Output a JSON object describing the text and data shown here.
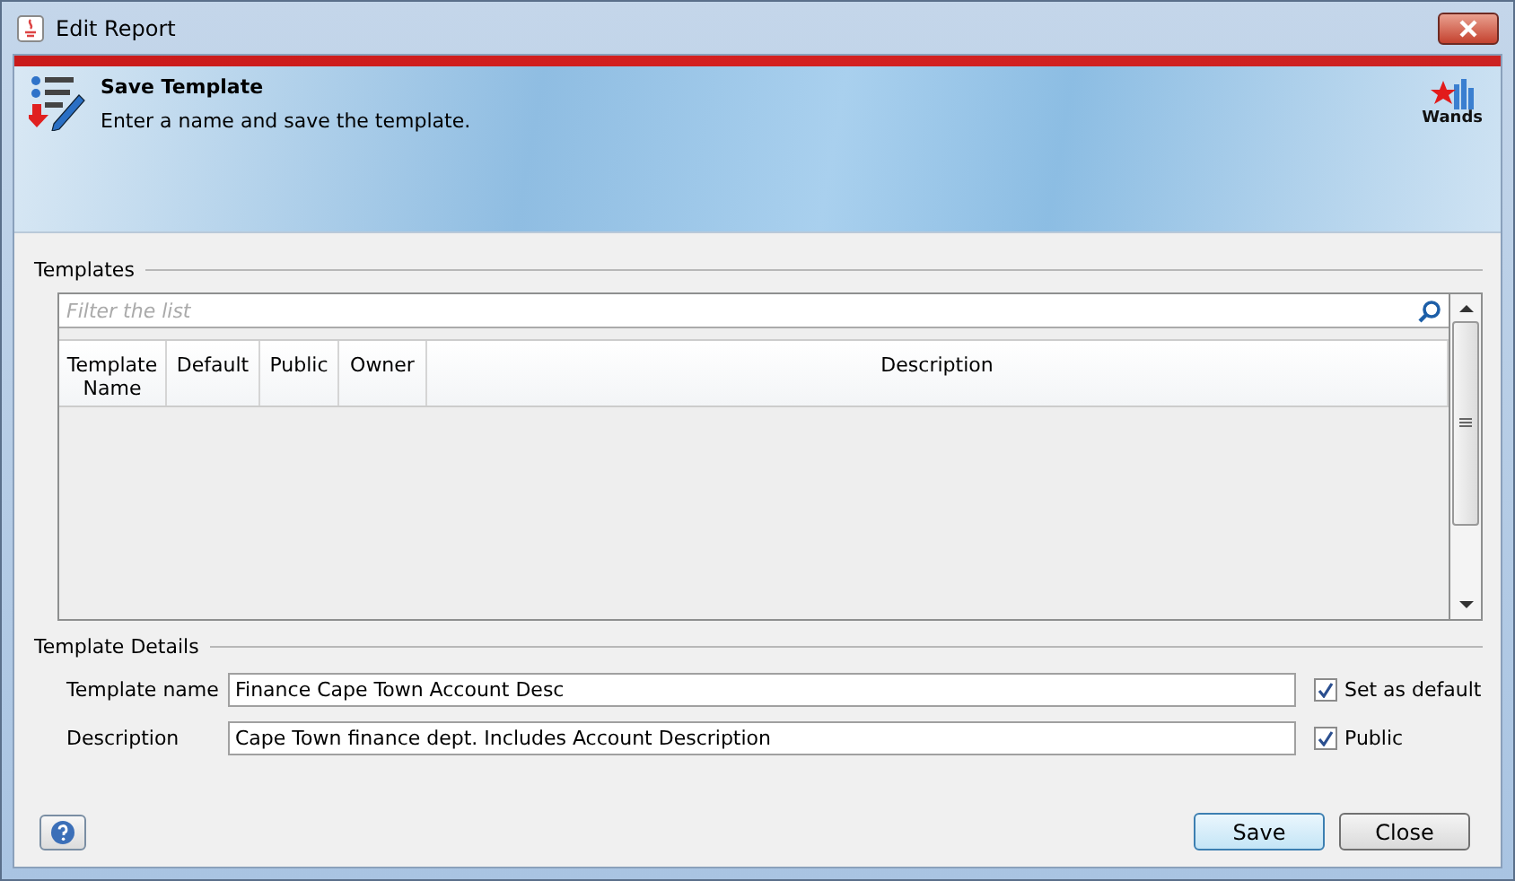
{
  "window": {
    "title": "Edit Report"
  },
  "header": {
    "title": "Save Template",
    "subtitle": "Enter a name and save the template.",
    "logo_text": "Wands"
  },
  "templates": {
    "label": "Templates",
    "filter_placeholder": "Filter the list",
    "columns": [
      {
        "label": "Template Name"
      },
      {
        "label": "Default"
      },
      {
        "label": "Public"
      },
      {
        "label": "Owner"
      },
      {
        "label": "Description"
      }
    ]
  },
  "details": {
    "label": "Template Details",
    "fields": [
      {
        "label": "Template name",
        "value": "Finance Cape Town Account Desc",
        "option": {
          "label": "Set as default",
          "checked": true
        }
      },
      {
        "label": "Description",
        "value": "Cape Town finance dept. Includes Account Description",
        "option": {
          "label": "Public",
          "checked": true
        }
      }
    ]
  },
  "buttons": [
    "Save",
    "Close"
  ]
}
